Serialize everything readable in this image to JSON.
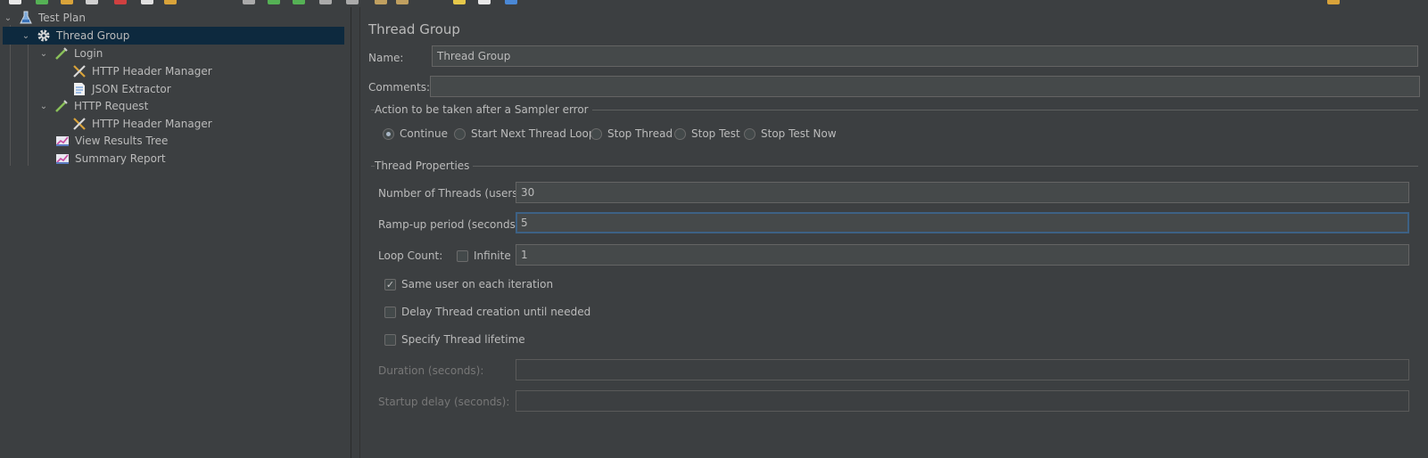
{
  "toolbar": {
    "icons": [
      {
        "name": "new-icon",
        "color": "#e8e8e8"
      },
      {
        "name": "templates-icon",
        "color": "#55b155"
      },
      {
        "name": "open-icon",
        "color": "#d9a33a"
      },
      {
        "name": "save-icon",
        "color": "#d0d0d0"
      },
      {
        "name": "cut-icon",
        "color": "#d04040"
      },
      {
        "name": "copy-icon",
        "color": "#e0e0e0"
      },
      {
        "name": "paste-icon",
        "color": "#d9a33a"
      },
      {
        "name": "expand-icon",
        "color": "#aaaaaa"
      },
      {
        "name": "start-icon",
        "color": "#55b155"
      },
      {
        "name": "start-no-pause-icon",
        "color": "#55b155"
      },
      {
        "name": "stop-icon",
        "color": "#aaaaaa"
      },
      {
        "name": "shutdown-icon",
        "color": "#aaaaaa"
      },
      {
        "name": "clear-icon",
        "color": "#c0a060"
      },
      {
        "name": "clear-all-icon",
        "color": "#c0a060"
      },
      {
        "name": "search-icon",
        "color": "#e6c84a"
      },
      {
        "name": "function-helper-icon",
        "color": "#e8e8e8"
      },
      {
        "name": "help-icon",
        "color": "#4a88d6"
      },
      {
        "name": "warning-icon",
        "color": "#d9a33a"
      }
    ]
  },
  "tree": {
    "items": [
      {
        "label": "Test Plan",
        "icon": "flask-icon",
        "level": 0,
        "expanded": true,
        "selected": false
      },
      {
        "label": "Thread Group",
        "icon": "gear-icon",
        "level": 1,
        "expanded": true,
        "selected": true
      },
      {
        "label": "Login",
        "icon": "pipette-icon",
        "level": 2,
        "expanded": true,
        "selected": false
      },
      {
        "label": "HTTP Header Manager",
        "icon": "wrench-icon",
        "level": 3,
        "expanded": null,
        "selected": false
      },
      {
        "label": "JSON Extractor",
        "icon": "document-icon",
        "level": 3,
        "expanded": null,
        "selected": false
      },
      {
        "label": "HTTP Request",
        "icon": "pipette-icon",
        "level": 2,
        "expanded": true,
        "selected": false
      },
      {
        "label": "HTTP Header Manager",
        "icon": "wrench-icon",
        "level": 3,
        "expanded": null,
        "selected": false
      },
      {
        "label": "View Results Tree",
        "icon": "chart-icon",
        "level": 2,
        "expanded": null,
        "selected": false
      },
      {
        "label": "Summary Report",
        "icon": "chart-icon",
        "level": 2,
        "expanded": null,
        "selected": false
      }
    ]
  },
  "panel": {
    "title": "Thread Group",
    "name_label": "Name:",
    "name_value": "Thread Group",
    "comments_label": "Comments:",
    "comments_value": "",
    "error_action": {
      "title": "Action to be taken after a Sampler error",
      "options": [
        {
          "label": "Continue",
          "checked": true
        },
        {
          "label": "Start Next Thread Loop",
          "checked": false
        },
        {
          "label": "Stop Thread",
          "checked": false
        },
        {
          "label": "Stop Test",
          "checked": false
        },
        {
          "label": "Stop Test Now",
          "checked": false
        }
      ]
    },
    "thread_props": {
      "title": "Thread Properties",
      "threads_label": "Number of Threads (users):",
      "threads_value": "30",
      "rampup_label": "Ramp-up period (seconds):",
      "rampup_value": "5",
      "loop_label": "Loop Count:",
      "infinite_label": "Infinite",
      "infinite_checked": false,
      "loop_value": "1",
      "same_user_label": "Same user on each iteration",
      "same_user_checked": true,
      "delay_label": "Delay Thread creation until needed",
      "delay_checked": false,
      "lifetime_label": "Specify Thread lifetime",
      "lifetime_checked": false,
      "duration_label": "Duration (seconds):",
      "duration_value": "",
      "startup_label": "Startup delay (seconds):",
      "startup_value": ""
    }
  }
}
